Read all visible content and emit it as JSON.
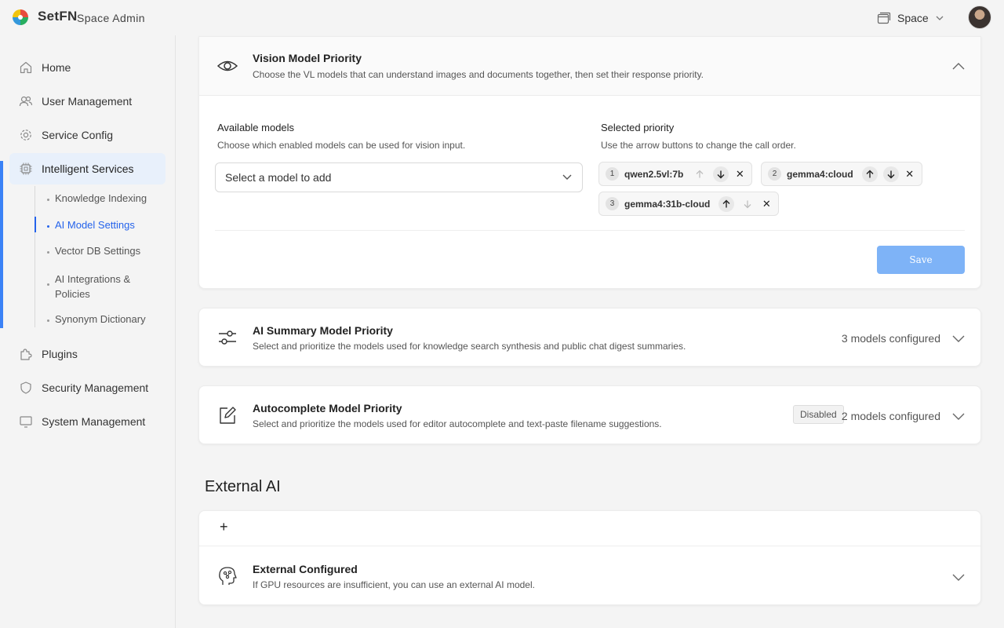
{
  "header": {
    "brand": "SetFN",
    "subtitle": "Space Admin",
    "space_label": "Space"
  },
  "sidebar": {
    "items": [
      {
        "label": "Home",
        "icon": "home-icon"
      },
      {
        "label": "User Management",
        "icon": "users-icon"
      },
      {
        "label": "Service Config",
        "icon": "gear-icon"
      },
      {
        "label": "Intelligent Services",
        "icon": "chip-icon"
      },
      {
        "label": "Plugins",
        "icon": "puzzle-icon"
      },
      {
        "label": "Security Management",
        "icon": "shield-icon"
      },
      {
        "label": "System Management",
        "icon": "monitor-icon"
      }
    ],
    "subitems": [
      {
        "label": "Knowledge Indexing"
      },
      {
        "label": "AI Model Settings"
      },
      {
        "label": "Vector DB Settings"
      },
      {
        "label": "AI Integrations & Policies"
      },
      {
        "label": "Synonym Dictionary"
      }
    ]
  },
  "vision": {
    "title": "Vision Model Priority",
    "desc": "Choose the VL models that can understand images and documents together, then set their response priority.",
    "available_label": "Available models",
    "available_hint": "Choose which enabled models can be used for vision input.",
    "select_placeholder": "Select a model to add",
    "selected_label": "Selected priority",
    "selected_hint": "Use the arrow buttons to change the call order.",
    "selected": [
      {
        "num": "1",
        "name": "qwen2.5vl:7b"
      },
      {
        "num": "2",
        "name": "gemma4:cloud"
      },
      {
        "num": "3",
        "name": "gemma4:31b-cloud"
      }
    ],
    "save_label": "Save"
  },
  "summary": {
    "title": "AI Summary Model Priority",
    "desc": "Select and prioritize the models used for knowledge search synthesis and public chat digest summaries.",
    "count": "3 models configured"
  },
  "autocomplete": {
    "title": "Autocomplete Model Priority",
    "desc": "Select and prioritize the models used for editor autocomplete and text-paste filename suggestions.",
    "badge": "Disabled",
    "count": "2 models configured"
  },
  "external": {
    "heading": "External AI",
    "add_label": "+",
    "title": "External Configured",
    "desc": "If GPU resources are insufficient, you can use an external AI model."
  },
  "colors": {
    "accent": "#2563eb",
    "save_button": "#7eb3f7",
    "active_nav_bg": "#e8f0fb"
  }
}
